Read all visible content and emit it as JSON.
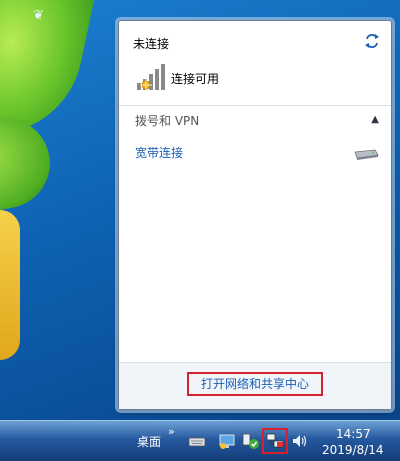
{
  "panel": {
    "status_title": "未连接",
    "available_text": "连接可用",
    "section_header": "拨号和 VPN",
    "broadband_label": "宽带连接",
    "footer_link": "打开网络和共享中心"
  },
  "taskbar": {
    "desktop_label": "桌面",
    "time": "14:57",
    "date": "2019/8/14"
  },
  "colors": {
    "link": "#1a5fb4",
    "highlight": "#d6212e"
  },
  "icons": [
    "refresh-icon",
    "signal-icon",
    "modem-icon",
    "keyboard-icon",
    "display-icon",
    "action-center-icon",
    "network-icon",
    "volume-icon",
    "chevron-up-icon"
  ]
}
